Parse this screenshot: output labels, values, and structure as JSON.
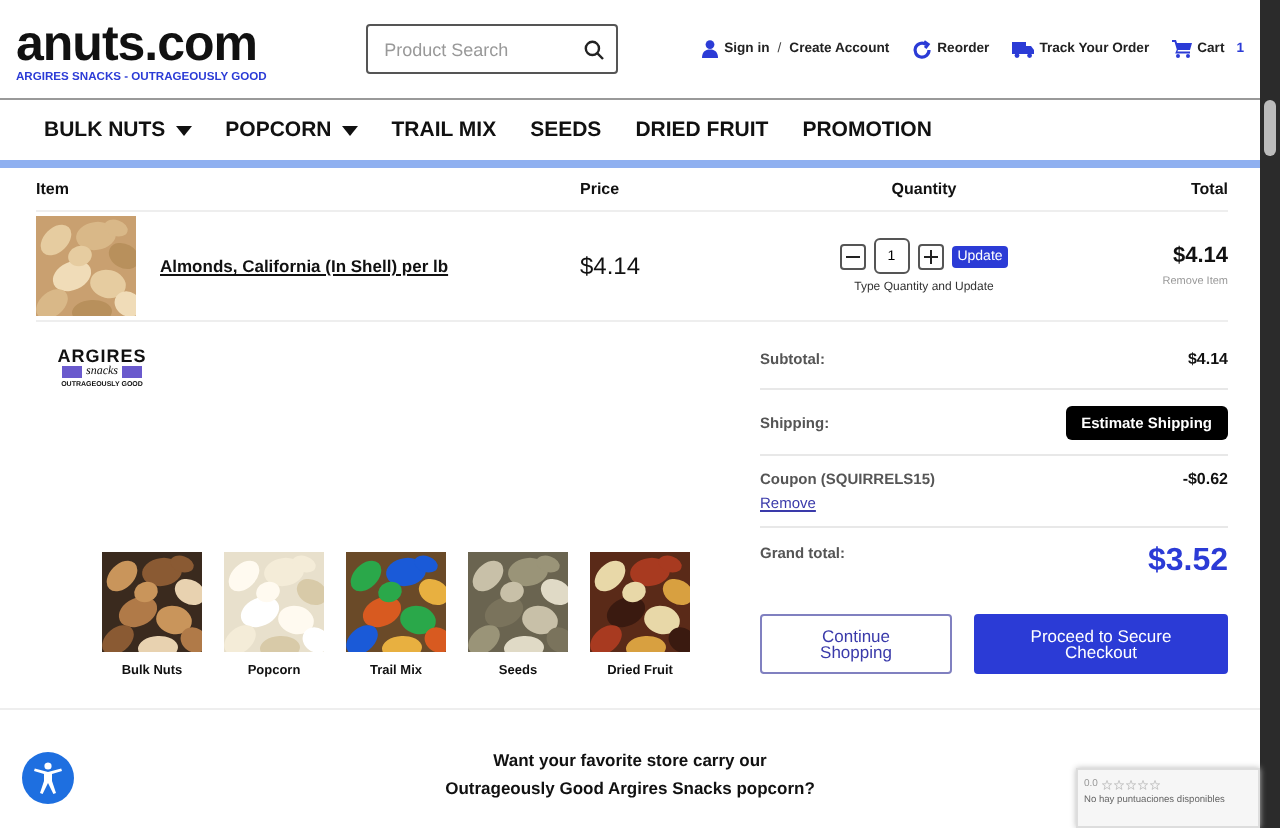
{
  "header": {
    "logo": "anuts.com",
    "tagline": "ARGIRES SNACKS - OUTRAGEOUSLY GOOD",
    "search": {
      "placeholder": "Product Search"
    },
    "links": [
      {
        "kind": "user",
        "label": "Sign in"
      },
      {
        "kind": "sep",
        "label": "/"
      },
      {
        "kind": "plain",
        "label": "Create Account"
      },
      {
        "kind": "reorder",
        "label": "Reorder"
      },
      {
        "kind": "truck",
        "label": "Track Your Order"
      },
      {
        "kind": "cart",
        "label": "Cart",
        "count": "1"
      }
    ]
  },
  "nav": [
    {
      "label": "BULK NUTS",
      "dropdown": true
    },
    {
      "label": "POPCORN",
      "dropdown": true
    },
    {
      "label": "TRAIL MIX",
      "dropdown": false
    },
    {
      "label": "SEEDS",
      "dropdown": false
    },
    {
      "label": "DRIED FRUIT",
      "dropdown": false
    },
    {
      "label": "PROMOTION",
      "dropdown": false
    }
  ],
  "table": {
    "columns": [
      "Item",
      "Price",
      "Quantity",
      "Total"
    ],
    "rows": [
      {
        "kind": "picture",
        "name": "Almonds, California (In Shell) per lb",
        "price": "$4.14",
        "quantity": "1",
        "update": "Update",
        "hint": "Type Quantity and Update",
        "total": "$4.14",
        "remove": "Remove Item"
      }
    ]
  },
  "brand": {
    "name": "ARGIRES",
    "script": "snacks",
    "tagline": "OUTRAGEOUSLY GOOD"
  },
  "categories": [
    {
      "label": "Bulk Nuts",
      "kind": "picture"
    },
    {
      "label": "Popcorn",
      "kind": "picture"
    },
    {
      "label": "Trail Mix",
      "kind": "picture"
    },
    {
      "label": "Seeds",
      "kind": "picture"
    },
    {
      "label": "Dried Fruit",
      "kind": "picture"
    }
  ],
  "summary": {
    "subtotal_label": "Subtotal:",
    "subtotal": "$4.14",
    "shipping_label": "Shipping:",
    "shipping_button": "Estimate Shipping",
    "coupon_label": "Coupon (SQUIRRELS15)",
    "coupon_remove": "Remove",
    "coupon": "-$0.62",
    "grand_label": "Grand total:",
    "grand": "$3.52"
  },
  "buttons": [
    {
      "kind": "outline",
      "label": "Continue Shopping"
    },
    {
      "kind": "primary",
      "label": "Proceed to Secure Checkout"
    }
  ],
  "footer": {
    "lines": [
      "Want your favorite store carry our",
      "Outrageously Good Argires Snacks popcorn?"
    ]
  },
  "rating": {
    "score": "0.0",
    "stars": 0,
    "text": "No hay puntuaciones disponibles"
  }
}
